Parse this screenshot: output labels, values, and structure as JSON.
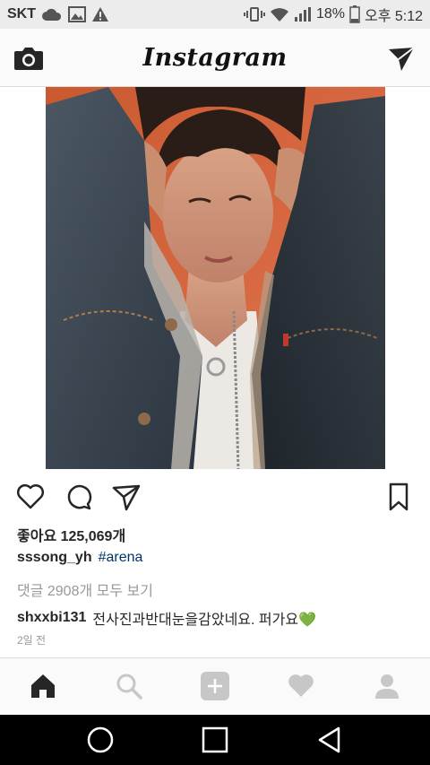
{
  "status_bar": {
    "carrier": "SKT",
    "battery_percent": "18%",
    "time": "오후 5:12"
  },
  "header": {
    "app_title": "Instagram"
  },
  "post": {
    "likes_text": "좋아요 125,069개",
    "caption_user": "sssong_yh",
    "caption_tag": "#arena",
    "view_comments": "댓글 2908개 모두 보기",
    "comment_user": "shxxbi131",
    "comment_text": "전사진과반대눈을감았네요. 퍼가요💚",
    "timestamp": "2일 전"
  },
  "colors": {
    "link": "#003569",
    "muted": "#999999",
    "text": "#262626"
  },
  "icons": {
    "status": [
      "cloud-icon",
      "gallery-icon",
      "warning-icon",
      "vibrate-icon",
      "wifi-icon",
      "signal-icon",
      "battery-icon"
    ],
    "header": [
      "camera-icon",
      "direct-send-icon"
    ],
    "actions": [
      "heart-icon",
      "comment-icon",
      "share-icon",
      "bookmark-icon"
    ],
    "tabs": [
      "home-icon",
      "search-icon",
      "add-icon",
      "activity-heart-icon",
      "profile-icon"
    ],
    "nav": [
      "back-icon",
      "home-circle-icon",
      "recents-icon"
    ]
  }
}
